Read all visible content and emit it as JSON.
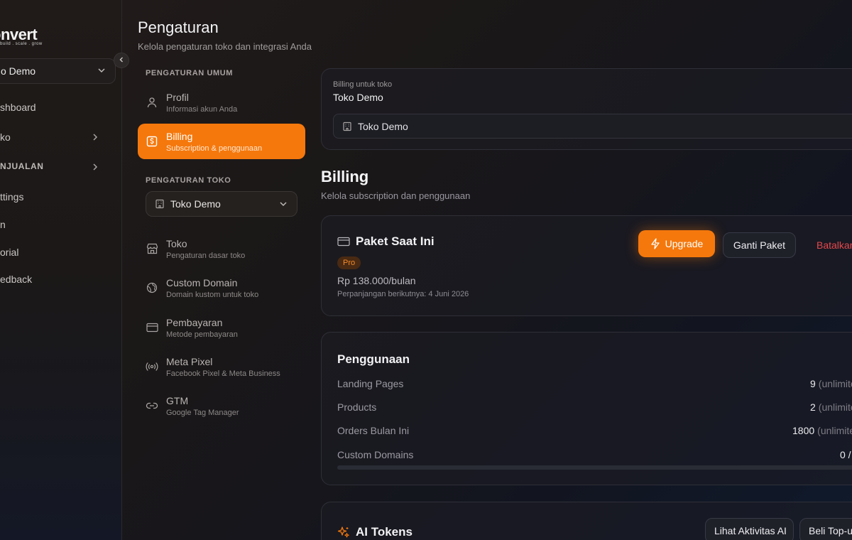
{
  "sidebar": {
    "logo": "onvert",
    "logo_tagline": "build . scale . grow",
    "store_name": "o Demo",
    "items": [
      {
        "label": "shboard"
      },
      {
        "label": "ko"
      },
      {
        "label": "NJUALAN"
      },
      {
        "label": "ttings"
      },
      {
        "label": "n"
      },
      {
        "label": "orial"
      },
      {
        "label": "edback"
      }
    ]
  },
  "header": {
    "title": "Pengaturan",
    "subtitle": "Kelola pengaturan toko dan integrasi Anda"
  },
  "settings_nav": {
    "general_label": "PENGATURAN UMUM",
    "store_label": "PENGATURAN TOKO",
    "selected_store": "Toko Demo",
    "general_items": [
      {
        "title": "Profil",
        "desc": "Informasi akun Anda"
      },
      {
        "title": "Billing",
        "desc": "Subscription & penggunaan"
      }
    ],
    "store_items": [
      {
        "title": "Toko",
        "desc": "Pengaturan dasar toko"
      },
      {
        "title": "Custom Domain",
        "desc": "Domain kustom untuk toko"
      },
      {
        "title": "Pembayaran",
        "desc": "Metode pembayaran"
      },
      {
        "title": "Meta Pixel",
        "desc": "Facebook Pixel & Meta Business"
      },
      {
        "title": "GTM",
        "desc": "Google Tag Manager"
      }
    ]
  },
  "billing_store": {
    "label": "Billing untuk toko",
    "name": "Toko Demo",
    "select_value": "Toko Demo"
  },
  "billing": {
    "title": "Billing",
    "subtitle": "Kelola subscription dan penggunaan"
  },
  "plan": {
    "title": "Paket Saat Ini",
    "badge": "Pro",
    "price": "Rp 138.000/bulan",
    "renewal": "Perpanjangan berikutnya: 4 Juni 2026",
    "upgrade_label": "Upgrade",
    "change_label": "Ganti Paket",
    "cancel_label": "Batalkan"
  },
  "usage": {
    "title": "Penggunaan",
    "rows": [
      {
        "label": "Landing Pages",
        "value": "9",
        "unit": "(unlimited)"
      },
      {
        "label": "Products",
        "value": "2",
        "unit": "(unlimited)"
      },
      {
        "label": "Orders Bulan Ini",
        "value": "1800",
        "unit": "(unlimited)"
      },
      {
        "label": "Custom Domains",
        "value": "0 /",
        "unit": ""
      }
    ]
  },
  "ai_tokens": {
    "title": "AI Tokens",
    "activity_label": "Lihat Aktivitas AI",
    "topup_label": "Beli Top-up"
  },
  "colors": {
    "accent": "#f5780c",
    "danger": "#e5484d",
    "badge_bg": "#4a2a12"
  }
}
